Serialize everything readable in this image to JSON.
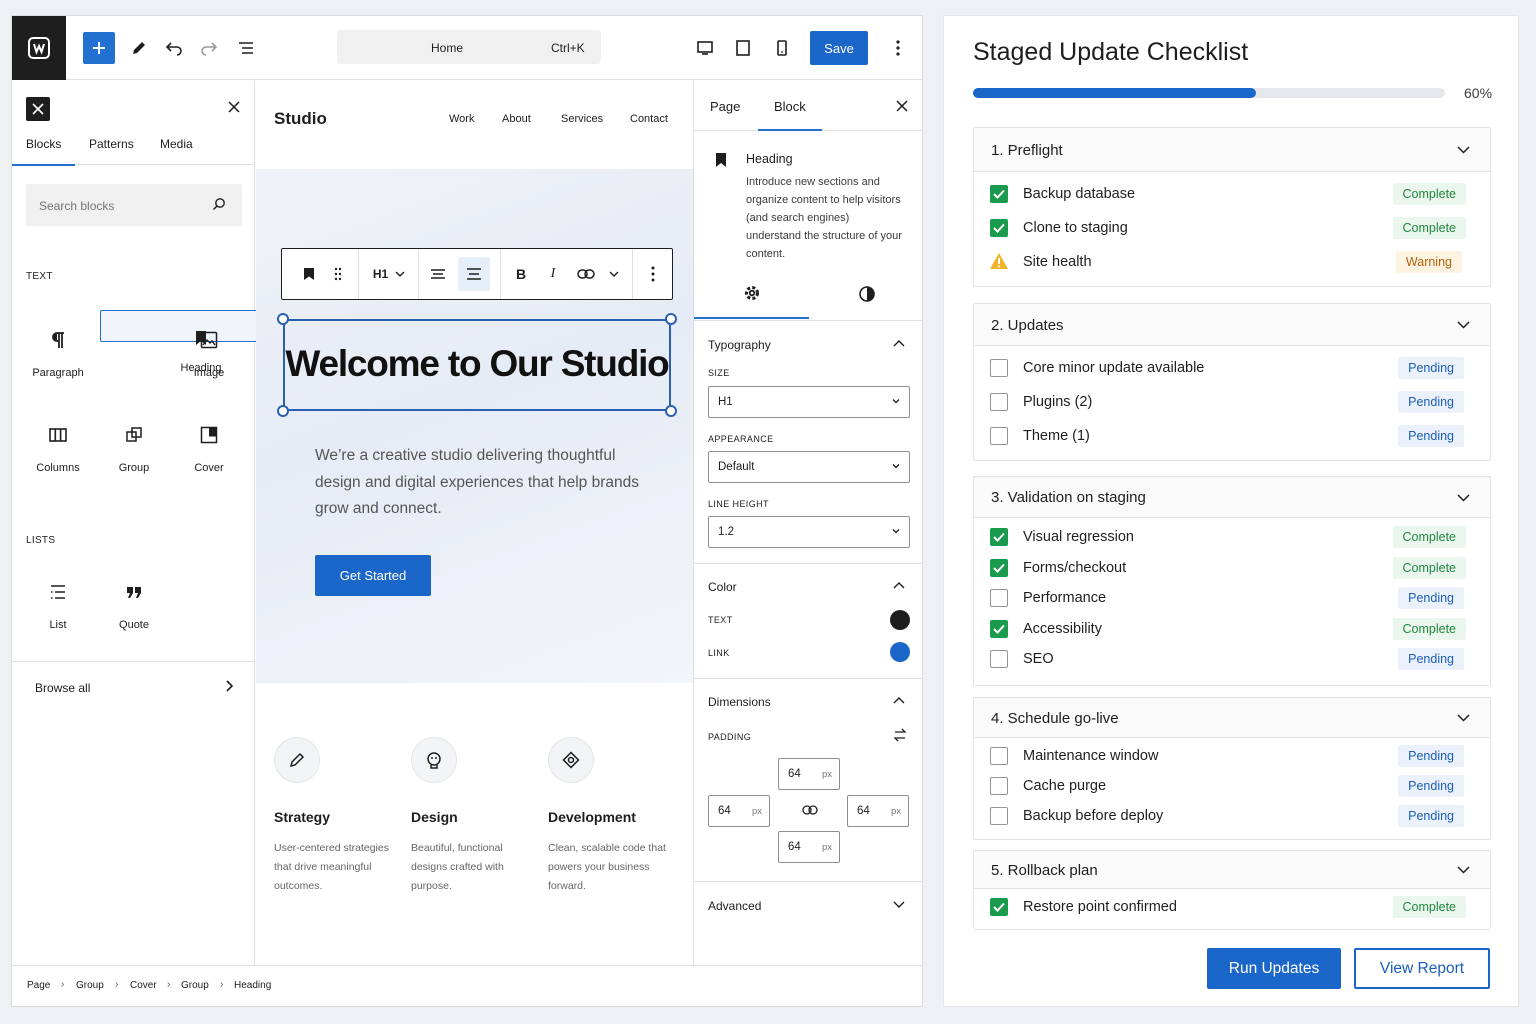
{
  "toolbar": {
    "command_label": "Home",
    "command_shortcut": "Ctrl+K",
    "save_label": "Save"
  },
  "inserter": {
    "tabs": [
      "Blocks",
      "Patterns",
      "Media"
    ],
    "search_placeholder": "Search blocks",
    "section_text": "TEXT",
    "section_lists": "LISTS",
    "blocks": [
      {
        "label": "Paragraph",
        "icon": "paragraph-icon"
      },
      {
        "label": "Heading",
        "icon": "bookmark-icon"
      },
      {
        "label": "Image",
        "icon": "image-icon"
      },
      {
        "label": "Columns",
        "icon": "columns-icon"
      },
      {
        "label": "Group",
        "icon": "group-icon"
      },
      {
        "label": "Cover",
        "icon": "cover-icon"
      },
      {
        "label": "List",
        "icon": "list-icon"
      },
      {
        "label": "Quote",
        "icon": "quote-icon"
      }
    ],
    "browse_all": "Browse all"
  },
  "canvas": {
    "brand": "Studio",
    "nav": [
      "Work",
      "About",
      "Services",
      "Contact"
    ],
    "block_toolbar": {
      "heading_level": "H1"
    },
    "headline": "Welcome to Our Studio",
    "hero_text": "We’re a creative studio delivering thoughtful design and digital experiences that help brands grow and connect.",
    "cta": "Get Started",
    "features": [
      {
        "title": "Strategy",
        "desc": "User-centered strategies that drive meaningful outcomes.",
        "icon": "pencil-icon"
      },
      {
        "title": "Design",
        "desc": "Beautiful, functional designs crafted with purpose.",
        "icon": "palette-icon"
      },
      {
        "title": "Development",
        "desc": "Clean, scalable code that powers your business forward.",
        "icon": "code-icon"
      }
    ]
  },
  "inspector": {
    "tabs": [
      "Page",
      "Block"
    ],
    "block_title": "Heading",
    "block_desc": "Introduce new sections and organize content to help visitors (and search engines) understand the structure of your content.",
    "typography": {
      "title": "Typography",
      "size_label": "SIZE",
      "size_value": "H1",
      "appearance_label": "APPEARANCE",
      "appearance_value": "Default",
      "line_height_label": "LINE HEIGHT",
      "line_height_value": "1.2"
    },
    "color": {
      "title": "Color",
      "text_label": "TEXT",
      "text_color": "#1e1e1e",
      "link_label": "LINK",
      "link_color": "#1b66c9"
    },
    "dimensions": {
      "title": "Dimensions",
      "padding_label": "PADDING",
      "top": "64",
      "left": "64",
      "right": "64",
      "bottom": "64",
      "unit": "px"
    },
    "advanced": "Advanced"
  },
  "breadcrumb": [
    "Page",
    "Group",
    "Cover",
    "Group",
    "Heading"
  ],
  "checklist": {
    "title": "Staged Update Checklist",
    "progress": 60,
    "progress_label": "60%",
    "groups": [
      {
        "title": "1. Preflight",
        "items": [
          {
            "label": "Backup database",
            "status": "Complete",
            "state": "checked"
          },
          {
            "label": "Clone to staging",
            "status": "Complete",
            "state": "checked"
          },
          {
            "label": "Site health",
            "status": "Warning",
            "state": "warning"
          }
        ]
      },
      {
        "title": "2. Updates",
        "items": [
          {
            "label": "Core minor update available",
            "status": "Pending",
            "state": "unchecked"
          },
          {
            "label": "Plugins (2)",
            "status": "Pending",
            "state": "unchecked"
          },
          {
            "label": "Theme (1)",
            "status": "Pending",
            "state": "unchecked"
          }
        ]
      },
      {
        "title": "3. Validation on staging",
        "items": [
          {
            "label": "Visual regression",
            "status": "Complete",
            "state": "checked"
          },
          {
            "label": "Forms/checkout",
            "status": "Complete",
            "state": "checked"
          },
          {
            "label": "Performance",
            "status": "Pending",
            "state": "unchecked"
          },
          {
            "label": "Accessibility",
            "status": "Complete",
            "state": "checked"
          },
          {
            "label": "SEO",
            "status": "Pending",
            "state": "unchecked"
          }
        ]
      },
      {
        "title": "4. Schedule go-live",
        "items": [
          {
            "label": "Maintenance window",
            "status": "Pending",
            "state": "unchecked"
          },
          {
            "label": "Cache purge",
            "status": "Pending",
            "state": "unchecked"
          },
          {
            "label": "Backup before deploy",
            "status": "Pending",
            "state": "unchecked"
          }
        ]
      },
      {
        "title": "5. Rollback plan",
        "items": [
          {
            "label": "Restore point confirmed",
            "status": "Complete",
            "state": "checked"
          }
        ]
      }
    ],
    "run_label": "Run Updates",
    "view_label": "View Report"
  },
  "colors": {
    "accent": "#1b66c9",
    "complete": "#22883f",
    "warning": "#b0650a",
    "pending": "#1b5fb8"
  }
}
